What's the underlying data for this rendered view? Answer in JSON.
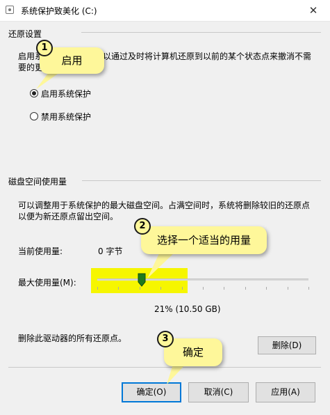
{
  "window": {
    "title": "系统保护致美化 (C:)",
    "close_glyph": "✕"
  },
  "restore": {
    "section_title": "还原设置",
    "desc_line1_left": "启用系",
    "desc_line1_right": "以通过及时将计算机还原到以前的某个状态点来撤消不需",
    "desc_line2": "要的更",
    "options": [
      {
        "label": "启用系统保护",
        "selected": true
      },
      {
        "label": "禁用系统保护",
        "selected": false
      }
    ]
  },
  "disk": {
    "section_title": "磁盘空间使用量",
    "desc_line1": "可以调整用于系统保护的最大磁盘空间。占满空间时，系统将删除较旧的还原点",
    "desc_line2": "以便为新还原点留出空间。",
    "current_label": "当前使用量:",
    "current_value": "0 字节",
    "max_label": "最大使用量(M):",
    "slider_value_percent": 21,
    "usage_text": "21% (10.50 GB)",
    "delete_desc": "删除此驱动器的所有还原点。",
    "delete_button": "删除(D)"
  },
  "buttons": {
    "ok": "确定(O)",
    "cancel": "取消(C)",
    "apply": "应用(A)"
  },
  "callouts": [
    {
      "number": "1",
      "text": "启用"
    },
    {
      "number": "2",
      "text": "选择一个适当的用量"
    },
    {
      "number": "3",
      "text": "确定"
    }
  ],
  "colors": {
    "callout": "#fef79a",
    "highlight": "#f6f600",
    "slider_thumb": "#1e7a1e",
    "default_button_border": "#0078d7"
  }
}
